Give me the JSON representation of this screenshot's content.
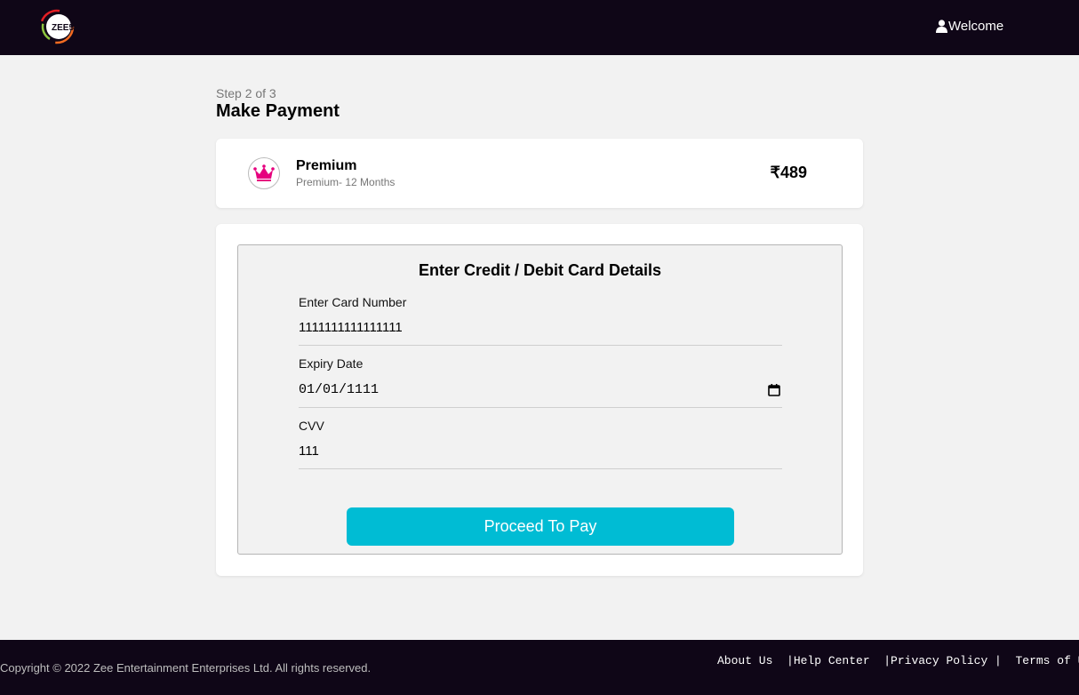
{
  "header": {
    "logo_text": "ZEE5",
    "welcome_label": "Welcome"
  },
  "page": {
    "step": "Step 2 of 3",
    "title": "Make Payment"
  },
  "plan": {
    "name": "Premium",
    "description": "Premium- 12 Months",
    "price": "₹489",
    "icon": "crown-icon",
    "icon_color": "#e6007e"
  },
  "payment_form": {
    "title": "Enter Credit / Debit Card Details",
    "card_number_label": "Enter Card Number",
    "card_number_value": "1111111111111111",
    "expiry_label": "Expiry Date",
    "expiry_value": "01/01/1111",
    "cvv_label": "CVV",
    "cvv_value": "111",
    "submit_label": "Proceed To Pay",
    "submit_color": "#00bcd4"
  },
  "footer": {
    "copyright": "Copyright © 2022 Zee Entertainment Enterprises Ltd. All rights reserved.",
    "links": [
      "About Us  ",
      "|Help Center  ",
      "|Privacy Policy |  ",
      "Terms of Use"
    ]
  },
  "colors": {
    "topbar_bg": "#0f0617",
    "page_bg": "#f2f2f2",
    "accent": "#00bcd4"
  }
}
